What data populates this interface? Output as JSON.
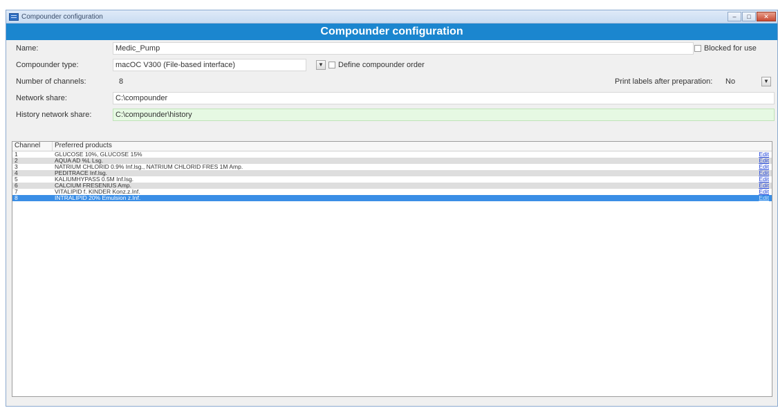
{
  "window": {
    "title": "Compounder configuration",
    "controls": {
      "minimize": "–",
      "maximize": "□",
      "close": "✕"
    }
  },
  "banner": {
    "title": "Compounder configuration"
  },
  "form": {
    "name_label": "Name:",
    "name_value": "Medic_Pump",
    "blocked_label": "Blocked for use",
    "type_label": "Compounder type:",
    "type_value": "macOC V300 (File-based interface)",
    "define_order_label": "Define compounder order",
    "channels_label": "Number of channels:",
    "channels_value": "8",
    "print_labels_label": "Print labels after preparation:",
    "print_labels_value": "No",
    "network_share_label": "Network share:",
    "network_share_value": "C:\\compounder",
    "history_share_label": "History network share:",
    "history_share_value": "C:\\compounder\\history"
  },
  "table": {
    "headers": {
      "channel": "Channel",
      "products": "Preferred products"
    },
    "edit_label": "Edit",
    "rows": [
      {
        "channel": "1",
        "products": "GLUCOSE 10%, GLUCOSE 15%"
      },
      {
        "channel": "2",
        "products": "AQUA AD %L Lsg."
      },
      {
        "channel": "3",
        "products": "NATRIUM CHLORID 0.9% Inf.lsg., NATRIUM CHLORID FRES 1M Amp."
      },
      {
        "channel": "4",
        "products": "PEDITRACE Inf.lsg."
      },
      {
        "channel": "5",
        "products": "KALIUMHYPASS 0.5M Inf.lsg."
      },
      {
        "channel": "6",
        "products": "CALCIUM FRESENIUS Amp."
      },
      {
        "channel": "7",
        "products": "VITALIPID f. KINDER Konz.z.Inf."
      },
      {
        "channel": "8",
        "products": "INTRALIPID 20% Emulsion z.Inf."
      }
    ],
    "selected_row": 8
  }
}
